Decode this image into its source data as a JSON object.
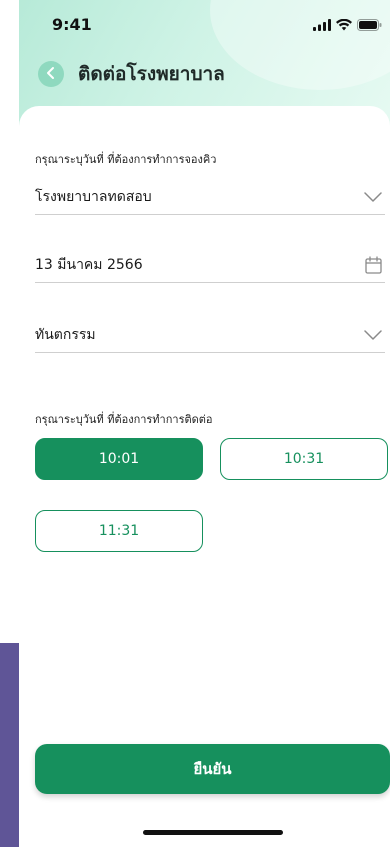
{
  "status_bar": {
    "time": "9:41",
    "icons": [
      "signal-icon",
      "wifi-icon",
      "battery-icon"
    ]
  },
  "header": {
    "title": "ติดต่อโรงพยาบาล",
    "back_icon": "chevron-left-icon"
  },
  "form": {
    "date_section_label": "กรุณาระบุวันที่ ที่ต้องการทำการจองคิว",
    "hospital": {
      "value": "โรงพยาบาลทดสอบ",
      "icon": "chevron-down-icon"
    },
    "date": {
      "value": "13 มีนาคม 2566",
      "icon": "calendar-icon"
    },
    "department": {
      "value": "ทันตกรรม",
      "icon": "chevron-down-icon"
    },
    "time_section_label": "กรุณาระบุวันที่ ที่ต้องการทำการติดต่อ",
    "time_slots": [
      {
        "label": "10:01",
        "selected": true
      },
      {
        "label": "10:31",
        "selected": false
      },
      {
        "label": "11:31",
        "selected": false
      }
    ]
  },
  "actions": {
    "confirm_label": "ยืนยัน"
  },
  "colors": {
    "primary": "#16905d",
    "header_gradient_start": "#b7ead8",
    "back_button": "#8fd9bf",
    "side_strip": "#5f5597"
  }
}
